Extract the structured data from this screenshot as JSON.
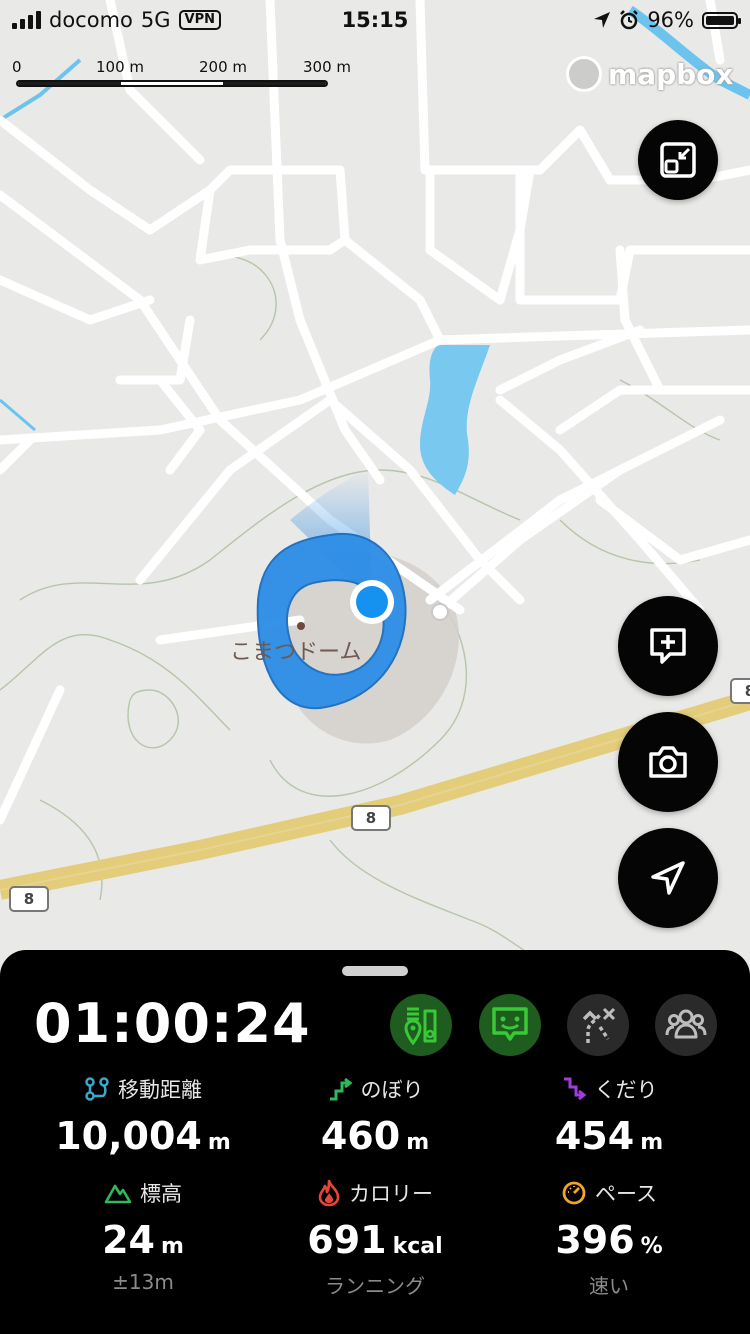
{
  "status_bar": {
    "carrier": "docomo",
    "network": "5G",
    "vpn": "VPN",
    "time": "15:15",
    "battery": "96%"
  },
  "map": {
    "scale_labels": [
      "0",
      "100 m",
      "200 m",
      "300 m"
    ],
    "attribution": "mapbox",
    "place_name": "こまつドーム",
    "route_shields": [
      "8",
      "8",
      "8"
    ]
  },
  "fabs": {
    "collapse_icon": "collapse-icon",
    "add_note_icon": "add-comment-icon",
    "camera_icon": "camera-icon",
    "locate_icon": "navigation-arrow-icon"
  },
  "panel": {
    "timer": "01:00:24",
    "mode_buttons": [
      {
        "name": "waypoint-mode-button",
        "icon": "waypoint-icon",
        "active": true
      },
      {
        "name": "emoji-mode-button",
        "icon": "smile-chat-icon",
        "active": true
      },
      {
        "name": "route-off-button",
        "icon": "route-off-icon",
        "active": false
      },
      {
        "name": "group-button",
        "icon": "group-icon",
        "active": false
      }
    ],
    "stats": {
      "distance": {
        "label": "移動距離",
        "value": "10,004",
        "unit": "m"
      },
      "ascent": {
        "label": "のぼり",
        "value": "460",
        "unit": "m"
      },
      "descent": {
        "label": "くだり",
        "value": "454",
        "unit": "m"
      },
      "elevation": {
        "label": "標高",
        "value": "24",
        "unit": "m",
        "sub": "±13m"
      },
      "calories": {
        "label": "カロリー",
        "value": "691",
        "unit": "kcal",
        "sub": "ランニング"
      },
      "pace": {
        "label": "ペース",
        "value": "396",
        "unit": "%",
        "sub": "速い"
      }
    }
  },
  "colors": {
    "route_blue": "#2f8fe6",
    "location_blue": "#1592f0",
    "active_green": "#1f5c1f",
    "accent_green": "#38c838",
    "ascent_green": "#2fb85c",
    "descent_purple": "#a03ce0",
    "calorie_red": "#e8443a",
    "pace_orange": "#f2a42c",
    "distance_teal": "#3aa8c8"
  }
}
